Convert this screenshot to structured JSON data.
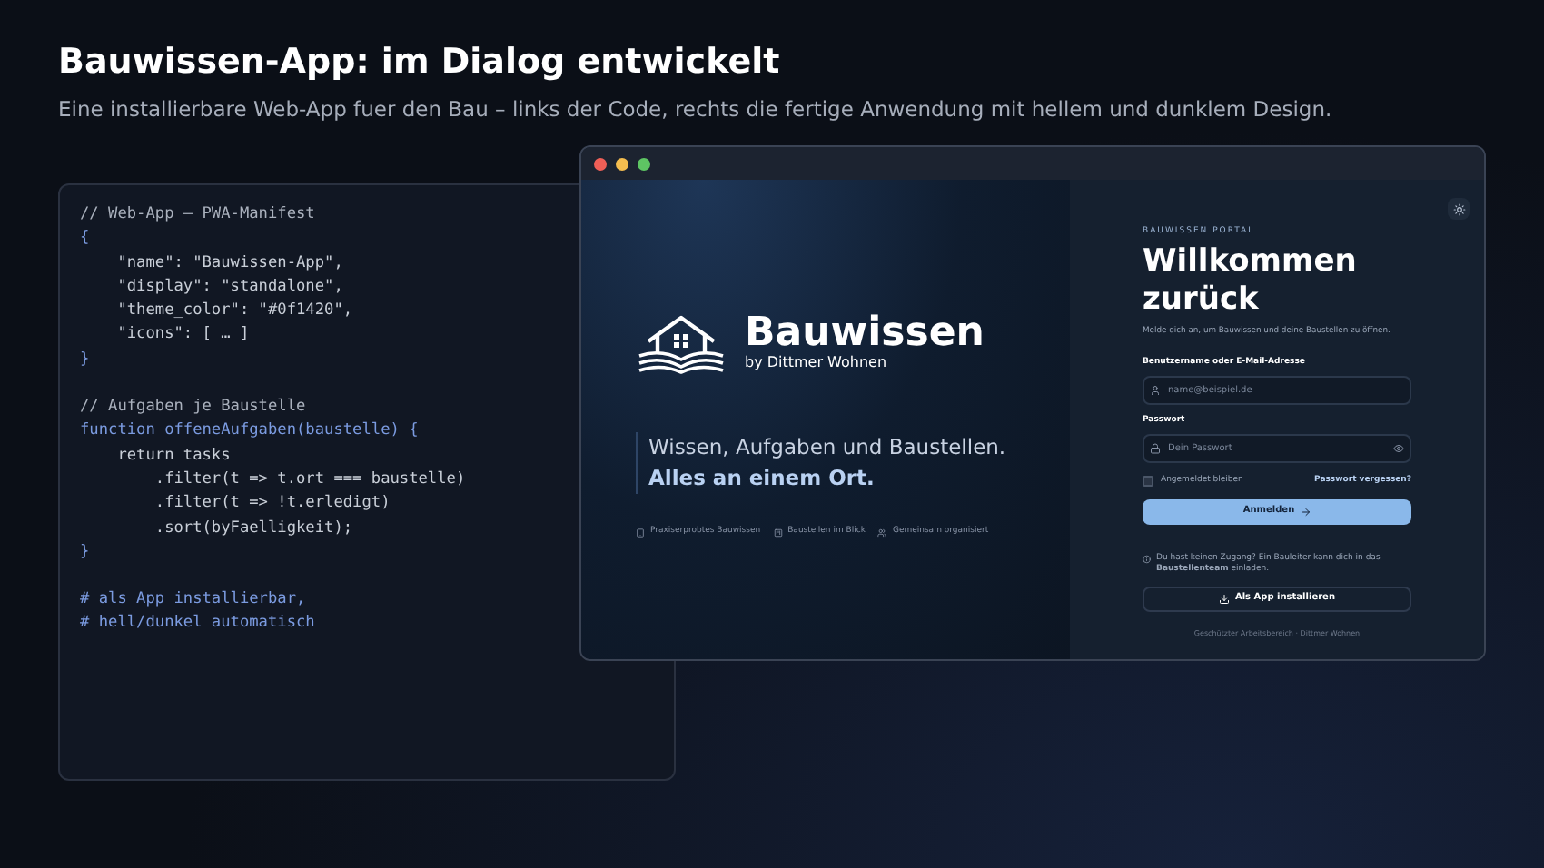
{
  "header": {
    "title": "Bauwissen-App: im Dialog entwickelt",
    "subtitle": "Eine installierbare Web-App fuer den Bau – links der Code, rechts die fertige Anwendung mit hellem und dunklem Design."
  },
  "code": {
    "blocks": [
      [
        {
          "text": "// Web-App – PWA-Manifest",
          "kind": "comment"
        },
        {
          "text": "{",
          "kind": "keyword"
        },
        {
          "text": "    \"name\": \"Bauwissen-App\",",
          "kind": "plain"
        },
        {
          "text": "    \"display\": \"standalone\",",
          "kind": "plain"
        },
        {
          "text": "    \"theme_color\": \"#0f1420\",",
          "kind": "plain"
        },
        {
          "text": "    \"icons\": [ … ]",
          "kind": "plain"
        },
        {
          "text": "}",
          "kind": "keyword"
        }
      ],
      [
        {
          "text": "// Aufgaben je Baustelle",
          "kind": "comment"
        },
        {
          "text": "function offeneAufgaben(baustelle) {",
          "kind": "keyword"
        },
        {
          "text": "    return tasks",
          "kind": "plain"
        },
        {
          "text": "        .filter(t => t.ort === baustelle)",
          "kind": "plain"
        },
        {
          "text": "        .filter(t => !t.erledigt)",
          "kind": "plain"
        },
        {
          "text": "        .sort(byFaelligkeit);",
          "kind": "plain"
        },
        {
          "text": "}",
          "kind": "keyword"
        }
      ],
      [
        {
          "text": "# als App installierbar,",
          "kind": "keyword"
        },
        {
          "text": "# hell/dunkel automatisch",
          "kind": "keyword"
        }
      ]
    ]
  },
  "app": {
    "brand": {
      "name": "Bauwissen",
      "byline": "by Dittmer Wohnen"
    },
    "tagline": {
      "line_1": "Wissen, Aufgaben und Baustellen.",
      "line_2": "Alles an einem Ort."
    },
    "features": [
      {
        "label": "Praxiserprobtes Bauwissen",
        "kind": "tablet"
      },
      {
        "label": "Baustellen im Blick",
        "kind": "board"
      },
      {
        "label": "Gemeinsam organisiert",
        "kind": "people"
      }
    ],
    "login": {
      "eyebrow": "BAUWISSEN PORTAL",
      "heading": "Willkommen zurück",
      "intro": "Melde dich an, um Bauwissen und deine Baustellen zu öffnen.",
      "user_label": "Benutzername oder E-Mail-Adresse",
      "user_placeholder": "name@beispiel.de",
      "password_label": "Passwort",
      "password_placeholder": "Dein Passwort",
      "remember": {
        "label": "Angemeldet bleiben",
        "checked": false
      },
      "forgot": "Passwort vergessen?",
      "submit": "Anmelden",
      "hint": "Du hast keinen Zugang? Ein Bauleiter kann dich in das **Baustellenteam** einladen.",
      "install": "Als App installieren",
      "footer": "Geschützter Arbeitsbereich · Dittmer Wohnen"
    }
  }
}
